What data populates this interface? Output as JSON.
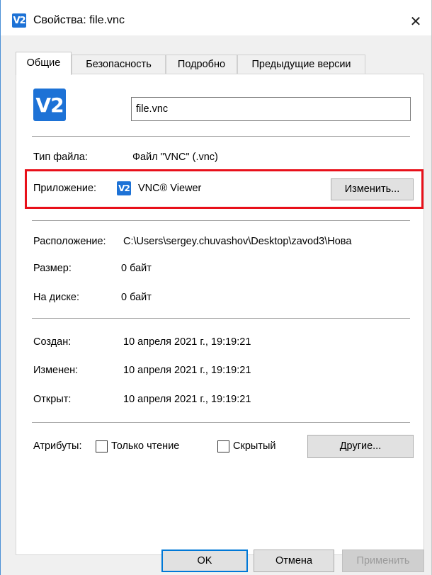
{
  "window": {
    "title": "Свойства: file.vnc",
    "close_glyph": "✕",
    "logo_glyph": "V2"
  },
  "tabs": [
    {
      "label": "Общие",
      "active": true
    },
    {
      "label": "Безопасность",
      "active": false
    },
    {
      "label": "Подробно",
      "active": false
    },
    {
      "label": "Предыдущие версии",
      "active": false
    }
  ],
  "general": {
    "file_name": "file.vnc",
    "file_type_label": "Тип файла:",
    "file_type_value": "Файл \"VNC\" (.vnc)",
    "app_label": "Приложение:",
    "app_value": "VNC® Viewer",
    "change_button": "Изменить...",
    "location_label": "Расположение:",
    "location_value": "C:\\Users\\sergey.chuvashov\\Desktop\\zavod3\\Нова",
    "size_label": "Размер:",
    "size_value": "0 байт",
    "on_disk_label": "На диске:",
    "on_disk_value": "0 байт",
    "created_label": "Создан:",
    "created_value": "10 апреля 2021 г., 19:19:21",
    "modified_label": "Изменен:",
    "modified_value": "10 апреля 2021 г., 19:19:21",
    "accessed_label": "Открыт:",
    "accessed_value": "10 апреля 2021 г., 19:19:21",
    "attributes_label": "Атрибуты:",
    "readonly_label": "Только чтение",
    "hidden_label": "Скрытый",
    "other_button": "Другие..."
  },
  "footer": {
    "ok": "OK",
    "cancel": "Отмена",
    "apply": "Применить"
  },
  "colors": {
    "highlight": "#e8101a",
    "vnc_blue": "#1d72d6",
    "default_button_border": "#0078d7"
  }
}
